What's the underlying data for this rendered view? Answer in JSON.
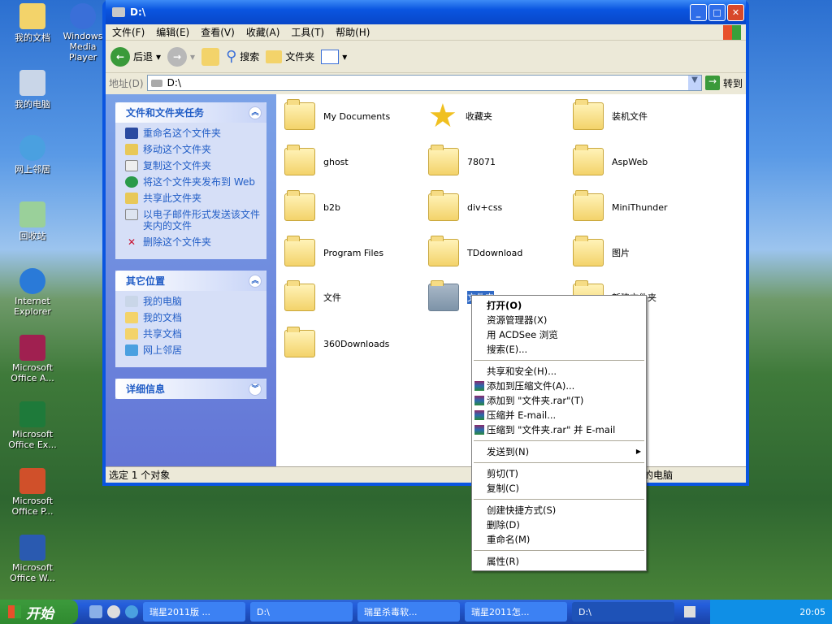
{
  "desktop": {
    "icons": [
      "我的文档",
      "Windows Media Player",
      "我的电脑",
      "网上邻居",
      "回收站",
      "Internet Explorer",
      "Microsoft Office A...",
      "Microsoft Office Ex...",
      "Microsoft Office P...",
      "Microsoft Office W..."
    ]
  },
  "window": {
    "title": "D:\\",
    "menu": [
      "文件(F)",
      "编辑(E)",
      "查看(V)",
      "收藏(A)",
      "工具(T)",
      "帮助(H)"
    ],
    "toolbar": {
      "back": "后退",
      "search": "搜索",
      "folders": "文件夹"
    },
    "address": {
      "label": "地址(D)",
      "value": "D:\\",
      "go": "转到"
    },
    "tasks": {
      "title": "文件和文件夹任务",
      "items": [
        "重命名这个文件夹",
        "移动这个文件夹",
        "复制这个文件夹",
        "将这个文件夹发布到 Web",
        "共享此文件夹",
        "以电子邮件形式发送该文件夹内的文件",
        "删除这个文件夹"
      ]
    },
    "places": {
      "title": "其它位置",
      "items": [
        "我的电脑",
        "我的文档",
        "共享文档",
        "网上邻居"
      ]
    },
    "details": {
      "title": "详细信息"
    },
    "files": [
      "My Documents",
      "收藏夹",
      "装机文件",
      "ghost",
      "78071",
      "AspWeb",
      "b2b",
      "div+css",
      "MiniThunder",
      "Program Files",
      "TDdownload",
      "图片",
      "文件",
      "文件夹",
      "新建文件夹",
      "360Downloads"
    ],
    "status": {
      "left": "选定 1 个对象",
      "right": "我的电脑"
    }
  },
  "context_menu": [
    "打开(O)",
    "资源管理器(X)",
    "用 ACDSee 浏览",
    "搜索(E)...",
    "共享和安全(H)...",
    "添加到压缩文件(A)...",
    "添加到 \"文件夹.rar\"(T)",
    "压缩并 E-mail...",
    "压缩到 \"文件夹.rar\" 并 E-mail",
    "发送到(N)",
    "剪切(T)",
    "复制(C)",
    "创建快捷方式(S)",
    "删除(D)",
    "重命名(M)",
    "属性(R)"
  ],
  "taskbar": {
    "start": "开始",
    "tasks": [
      "瑞星2011版 ...",
      "D:\\",
      "瑞星杀毒软...",
      "瑞星2011怎...",
      "D:\\"
    ],
    "clock": "20:05"
  }
}
